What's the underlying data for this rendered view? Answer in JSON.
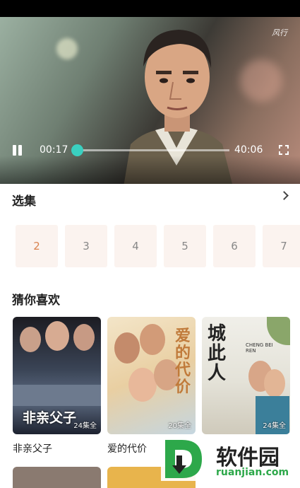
{
  "player": {
    "current_time": "00:17",
    "duration": "40:06",
    "progress": 0.007,
    "watermark": "风行"
  },
  "episodes": {
    "title": "选集",
    "items": [
      "2",
      "3",
      "4",
      "5",
      "6",
      "7"
    ],
    "active": "2"
  },
  "recommend": {
    "title": "猜你喜欢",
    "cards": [
      {
        "name": "非亲父子",
        "badge": "24集全",
        "poster_text": "非亲父子"
      },
      {
        "name": "爱的代价",
        "badge": "20集全",
        "poster_text": "爱的代价"
      },
      {
        "name": "",
        "badge": "24集全",
        "poster_text": "城此人",
        "sub": "CHENG BEI REN"
      }
    ]
  },
  "watermark_site": {
    "brand": "软件园",
    "domain": "ruanjian.com"
  },
  "colors": {
    "accent": "#3ad0c0",
    "active_episode": "#d9824f",
    "episode_bg": "#fbf3ef"
  }
}
